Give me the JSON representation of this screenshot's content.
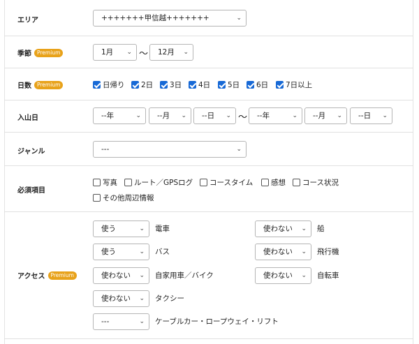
{
  "area": {
    "label": "エリア",
    "value": "+++++++甲信越+++++++"
  },
  "season": {
    "label": "季節",
    "badge": "Premium",
    "from": "1月",
    "tilde": "〜",
    "to": "12月"
  },
  "days": {
    "label": "日数",
    "badge": "Premium",
    "options": [
      {
        "label": "日帰り",
        "checked": true
      },
      {
        "label": "2日",
        "checked": true
      },
      {
        "label": "3日",
        "checked": true
      },
      {
        "label": "4日",
        "checked": true
      },
      {
        "label": "5日",
        "checked": true
      },
      {
        "label": "6日",
        "checked": true
      },
      {
        "label": "7日以上",
        "checked": true
      }
    ]
  },
  "entry": {
    "label": "入山日",
    "year1": "--年",
    "month1": "--月",
    "day1": "--日",
    "tilde": "〜",
    "year2": "--年",
    "month2": "--月",
    "day2": "--日"
  },
  "genre": {
    "label": "ジャンル",
    "value": "---"
  },
  "required": {
    "label": "必須項目",
    "options": [
      {
        "label": "写真",
        "checked": false
      },
      {
        "label": "ルート／GPSログ",
        "checked": false
      },
      {
        "label": "コースタイム",
        "checked": false
      },
      {
        "label": "感想",
        "checked": false
      },
      {
        "label": "コース状況",
        "checked": false
      },
      {
        "label": "その他周辺情報",
        "checked": false
      }
    ]
  },
  "access": {
    "label": "アクセス",
    "badge": "Premium",
    "train": {
      "value": "使う",
      "label": "電車"
    },
    "bus": {
      "value": "使う",
      "label": "バス"
    },
    "car": {
      "value": "使わない",
      "label": "自家用車／バイク"
    },
    "taxi": {
      "value": "使わない",
      "label": "タクシー"
    },
    "cable": {
      "value": "---",
      "label": "ケーブルカー・ロープウェイ・リフト"
    },
    "ship": {
      "value": "使わない",
      "label": "船"
    },
    "plane": {
      "value": "使わない",
      "label": "飛行機"
    },
    "bike": {
      "value": "使わない",
      "label": "自転車"
    }
  },
  "colors": {
    "accent": "#1769d6",
    "badge": "#e8a21a",
    "border": "#e0e0e0"
  }
}
